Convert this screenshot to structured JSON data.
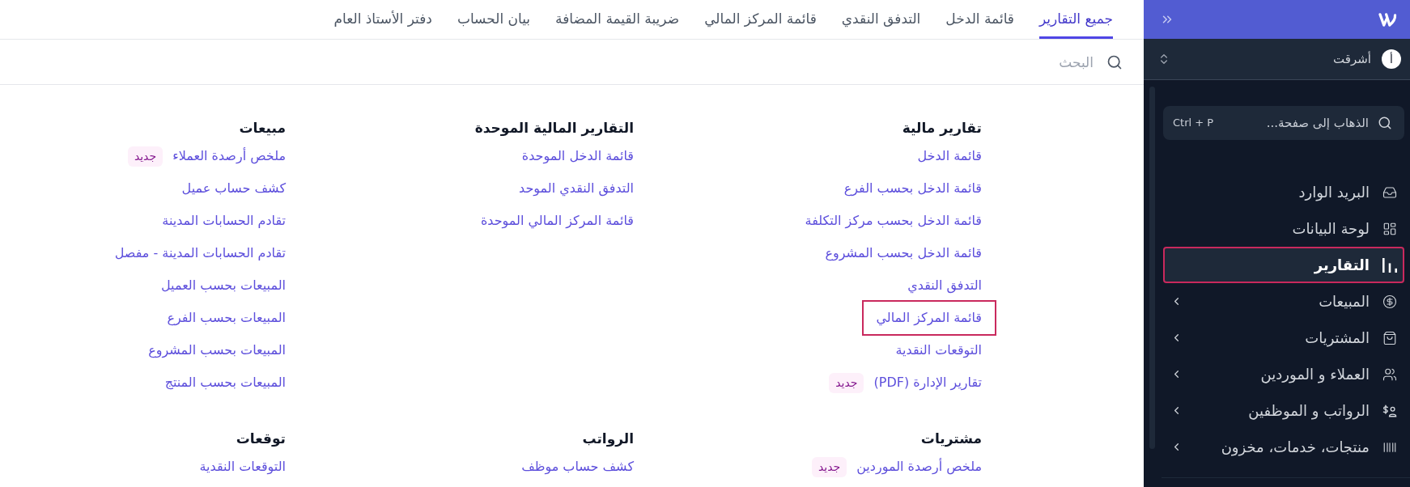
{
  "sidebar": {
    "workspace": {
      "avatar_initial": "أ",
      "name": "أشرقت"
    },
    "page_search": {
      "placeholder": "الذهاب إلى صفحة...",
      "shortcut": "Ctrl + P"
    },
    "nav_items": [
      {
        "label": "البريد الوارد",
        "selected": false,
        "outlined": false,
        "expandable": false
      },
      {
        "label": "لوحة البيانات",
        "selected": false,
        "outlined": false,
        "expandable": false
      },
      {
        "label": "التقارير",
        "selected": true,
        "outlined": true,
        "expandable": false
      },
      {
        "label": "المبيعات",
        "selected": false,
        "outlined": false,
        "expandable": true
      },
      {
        "label": "المشتريات",
        "selected": false,
        "outlined": false,
        "expandable": true
      },
      {
        "label": "العملاء و الموردين",
        "selected": false,
        "outlined": false,
        "expandable": true
      },
      {
        "label": "الرواتب و الموظفين",
        "selected": false,
        "outlined": false,
        "expandable": true
      },
      {
        "label": "منتجات، خدمات، مخزون",
        "selected": false,
        "outlined": false,
        "expandable": true
      }
    ]
  },
  "tabs": [
    {
      "label": "جميع التقارير",
      "selected": true
    },
    {
      "label": "قائمة الدخل",
      "selected": false
    },
    {
      "label": "التدفق النقدي",
      "selected": false
    },
    {
      "label": "قائمة المركز المالي",
      "selected": false
    },
    {
      "label": "ضريبة القيمة المضافة",
      "selected": false
    },
    {
      "label": "بيان الحساب",
      "selected": false
    },
    {
      "label": "دفتر الأستاذ العام",
      "selected": false
    }
  ],
  "search": {
    "placeholder": "البحث"
  },
  "report_sections": [
    {
      "title": "تقارير مالية",
      "links": [
        {
          "label": "قائمة الدخل",
          "outlined": false
        },
        {
          "label": "قائمة الدخل بحسب الفرع",
          "outlined": false
        },
        {
          "label": "قائمة الدخل بحسب مركز التكلفة",
          "outlined": false
        },
        {
          "label": "قائمة الدخل بحسب المشروع",
          "outlined": false
        },
        {
          "label": "التدفق النقدي",
          "outlined": false
        },
        {
          "label": "قائمة المركز المالي",
          "outlined": true
        },
        {
          "label": "التوقعات النقدية",
          "outlined": false
        },
        {
          "label": "تقارير الإدارة (PDF)",
          "outlined": false,
          "badge": "جديد"
        }
      ]
    },
    {
      "title": "التقارير المالية الموحدة",
      "links": [
        {
          "label": "قائمة الدخل الموحدة",
          "outlined": false
        },
        {
          "label": "التدفق النقدي الموحد",
          "outlined": false
        },
        {
          "label": "قائمة المركز المالي الموحدة",
          "outlined": false
        }
      ]
    },
    {
      "title": "مبيعات",
      "links": [
        {
          "label": "ملخص أرصدة العملاء",
          "outlined": false,
          "badge": "جديد"
        },
        {
          "label": "كشف حساب عميل",
          "outlined": false
        },
        {
          "label": "تقادم الحسابات المدينة",
          "outlined": false
        },
        {
          "label": "تقادم الحسابات المدينة - مفصل",
          "outlined": false
        },
        {
          "label": "المبيعات بحسب العميل",
          "outlined": false
        },
        {
          "label": "المبيعات بحسب الفرع",
          "outlined": false
        },
        {
          "label": "المبيعات بحسب المشروع",
          "outlined": false
        },
        {
          "label": "المبيعات بحسب المنتج",
          "outlined": false
        }
      ]
    },
    {
      "title": "مشتريات",
      "links": [
        {
          "label": "ملخص أرصدة الموردين",
          "outlined": false,
          "badge": "جديد"
        }
      ]
    },
    {
      "title": "الرواتب",
      "links": [
        {
          "label": "كشف حساب موظف",
          "outlined": false
        }
      ]
    },
    {
      "title": "توقعات",
      "links": [
        {
          "label": "التوقعات النقدية",
          "outlined": false
        }
      ]
    }
  ]
}
